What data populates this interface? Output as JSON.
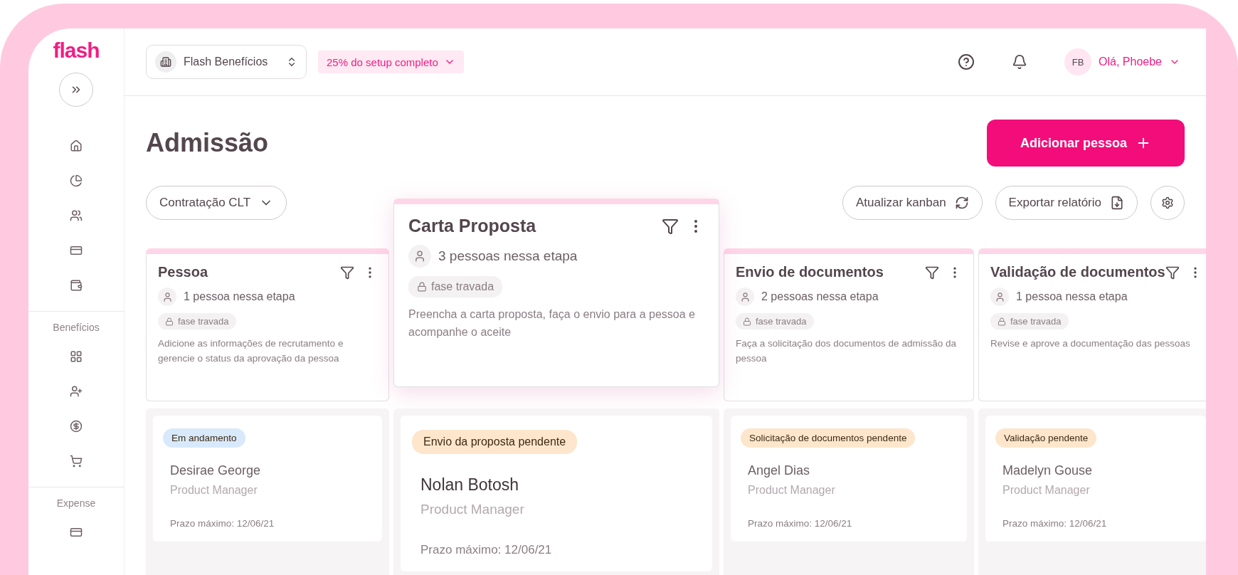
{
  "sidebar": {
    "logo": "flash",
    "sections": [
      {
        "label": "Benefícios"
      },
      {
        "label": "Expense"
      }
    ]
  },
  "topbar": {
    "company": "Flash Benefícios",
    "setup": "25% do setup completo",
    "avatar": "FB",
    "greeting": "Olá, Phoebe"
  },
  "page": {
    "title": "Admissão",
    "primary_button": "Adicionar pessoa",
    "filter": "Contratação CLT",
    "actions": [
      "Atualizar kanban",
      "Exportar relatório"
    ]
  },
  "columns": [
    {
      "title": "Pessoa",
      "count": "1 pessoa nessa etapa",
      "tag": "fase travada",
      "description": "Adicione as informações de recrutamento e gerencie o status da aprovação da pessoa",
      "dragging": false,
      "cards": [
        {
          "status": "Em andamento",
          "color": "#d8e9fb",
          "name": "Desirae George",
          "role": "Product Manager",
          "deadline": "Prazo máximo: 12/06/21"
        }
      ]
    },
    {
      "title": "Carta Proposta",
      "count": "3 pessoas nessa etapa",
      "tag": "fase travada",
      "description": "Preencha a carta proposta, faça o envio para a pessoa e acompanhe o aceite",
      "dragging": true,
      "cards": [
        {
          "status": "Envio da proposta pendente",
          "color": "#fde6cc",
          "name": "Nolan Botosh",
          "role": "Product Manager",
          "deadline": "Prazo máximo: 12/06/21"
        }
      ]
    },
    {
      "title": "Envio de documentos",
      "count": "2 pessoas nessa etapa",
      "tag": "fase travada",
      "description": "Faça a solicitação dos documentos de admissão da pessoa",
      "dragging": false,
      "cards": [
        {
          "status": "Solicitação de documentos pendente",
          "color": "#fde6cc",
          "name": "Angel Dias",
          "role": "Product Manager",
          "deadline": "Prazo máximo: 12/06/21"
        }
      ]
    },
    {
      "title": "Validação de documentos",
      "count": "1 pessoa nessa etapa",
      "tag": "fase travada",
      "description": "Revise e aprove a documentação das pessoas",
      "dragging": false,
      "cards": [
        {
          "status": "Validação pendente",
          "color": "#fde6cc",
          "name": "Madelyn Gouse",
          "role": "Product Manager",
          "deadline": "Prazo máximo: 12/06/21"
        }
      ]
    }
  ]
}
